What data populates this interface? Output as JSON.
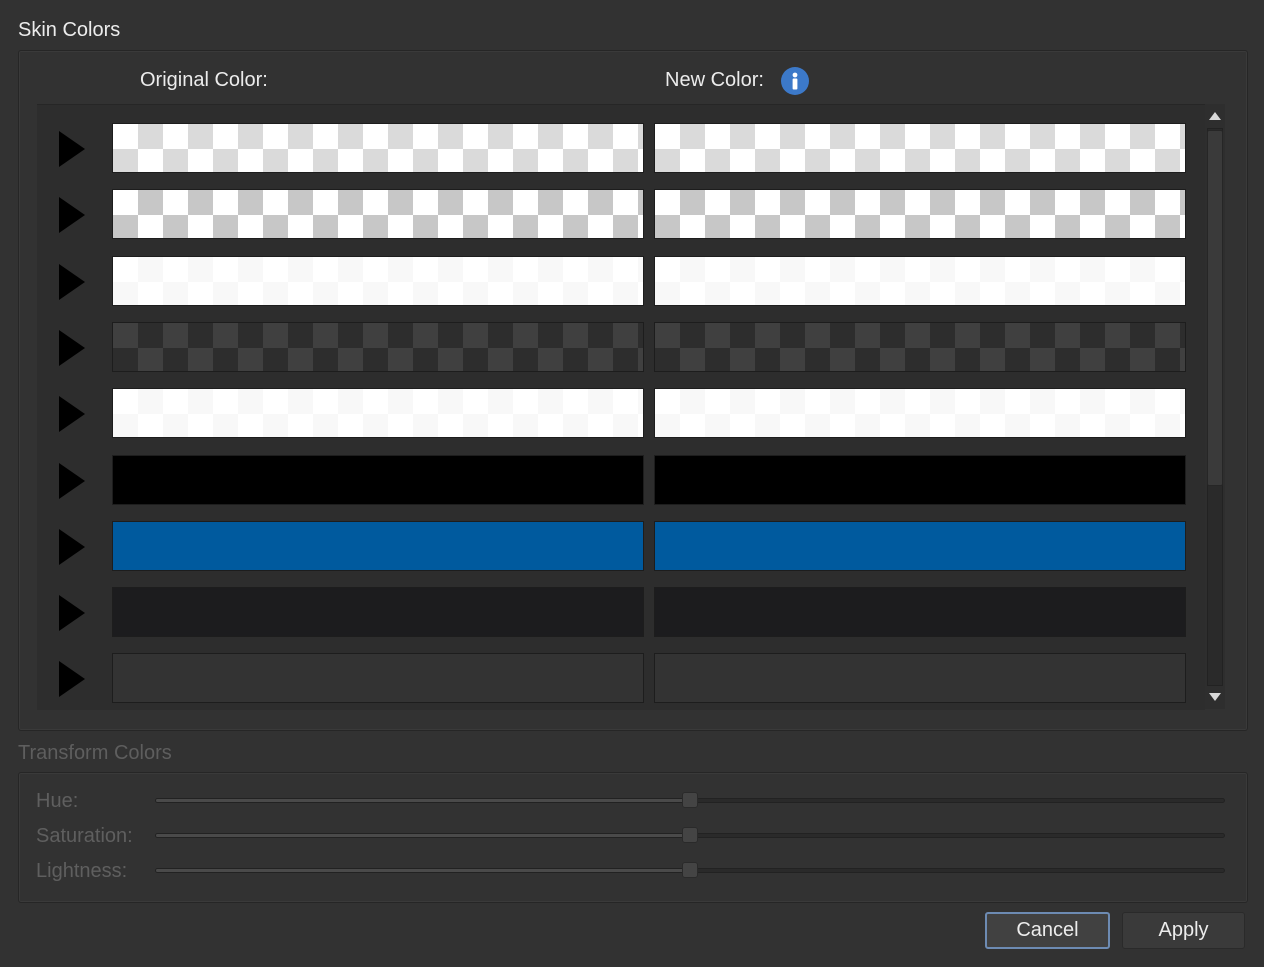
{
  "skin_colors": {
    "title": "Skin Colors",
    "original_header": "Original Color:",
    "new_header": "New Color:",
    "rows": [
      {
        "pattern": "checker",
        "color": "rgba(255,255,255,0.5)"
      },
      {
        "pattern": "checker",
        "color": "rgba(255,255,255,0.25)"
      },
      {
        "pattern": "checker",
        "color": "rgba(255,255,255,0.9)"
      },
      {
        "pattern": "checker",
        "color": "rgba(0,0,0,0.75)"
      },
      {
        "pattern": "checker",
        "color": "rgba(255,255,255,0.9)"
      },
      {
        "pattern": "solid",
        "color": "#000000"
      },
      {
        "pattern": "solid",
        "color": "#005a9e"
      },
      {
        "pattern": "solid",
        "color": "#1c1c1e"
      },
      {
        "pattern": "solid",
        "color": "#333333"
      }
    ]
  },
  "transform_colors": {
    "title": "Transform Colors",
    "sliders": [
      {
        "label": "Hue:",
        "value": 0.5
      },
      {
        "label": "Saturation:",
        "value": 0.5
      },
      {
        "label": "Lightness:",
        "value": 0.5
      }
    ]
  },
  "buttons": {
    "cancel": "Cancel",
    "apply": "Apply"
  },
  "colors": {
    "background": "#323232",
    "accent": "#3c79c9",
    "focus_ring": "#6d8bb3"
  }
}
